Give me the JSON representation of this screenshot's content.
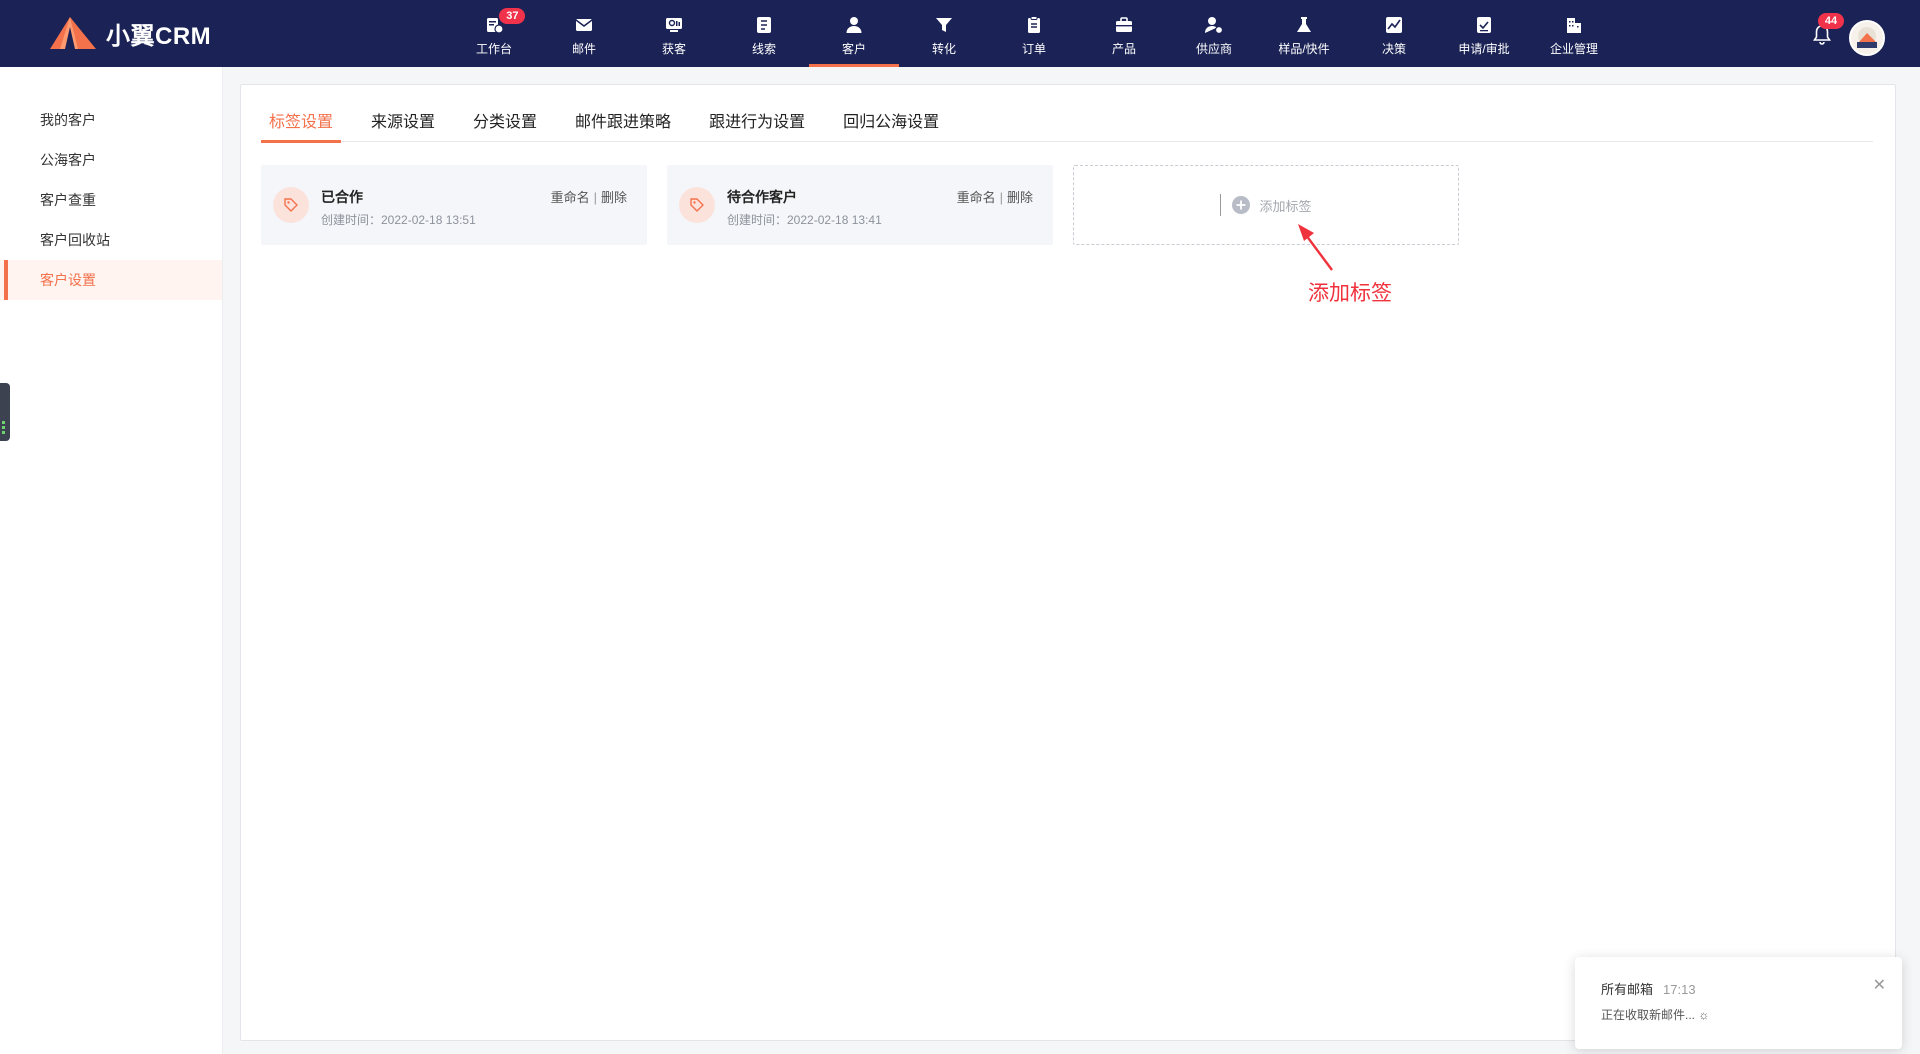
{
  "app": {
    "name": "小翼CRM",
    "brand_color": "#f3714b",
    "nav_bg": "#1b2356"
  },
  "nav": {
    "items": [
      {
        "label": "工作台",
        "icon": "workbench-icon",
        "badge": "37"
      },
      {
        "label": "邮件",
        "icon": "mail-icon"
      },
      {
        "label": "获客",
        "icon": "acquire-icon"
      },
      {
        "label": "线索",
        "icon": "leads-icon"
      },
      {
        "label": "客户",
        "icon": "customer-icon",
        "active": true
      },
      {
        "label": "转化",
        "icon": "funnel-icon"
      },
      {
        "label": "订单",
        "icon": "clipboard-icon"
      },
      {
        "label": "产品",
        "icon": "briefcase-icon"
      },
      {
        "label": "供应商",
        "icon": "supplier-icon"
      },
      {
        "label": "样品/快件",
        "icon": "flask-icon"
      },
      {
        "label": "决策",
        "icon": "chart-icon"
      },
      {
        "label": "申请/审批",
        "icon": "approval-icon"
      },
      {
        "label": "企业管理",
        "icon": "building-icon"
      }
    ],
    "bell_badge": "44"
  },
  "sidebar": {
    "items": [
      {
        "label": "我的客户"
      },
      {
        "label": "公海客户"
      },
      {
        "label": "客户查重"
      },
      {
        "label": "客户回收站"
      },
      {
        "label": "客户设置",
        "active": true
      }
    ]
  },
  "tabs": [
    {
      "label": "标签设置",
      "active": true
    },
    {
      "label": "来源设置"
    },
    {
      "label": "分类设置"
    },
    {
      "label": "邮件跟进策略"
    },
    {
      "label": "跟进行为设置"
    },
    {
      "label": "回归公海设置"
    }
  ],
  "tags": [
    {
      "name": "已合作",
      "created": "创建时间：2022-02-18 13:51",
      "rename": "重命名",
      "delete": "删除"
    },
    {
      "name": "待合作客户",
      "created": "创建时间：2022-02-18 13:41",
      "rename": "重命名",
      "delete": "删除"
    }
  ],
  "add_tag": {
    "label": "添加标签"
  },
  "annotation": {
    "text": "添加标签",
    "color": "#f0323c"
  },
  "toast": {
    "title": "所有邮箱",
    "time": "17:13",
    "message": "正在收取新邮件... ☼"
  }
}
